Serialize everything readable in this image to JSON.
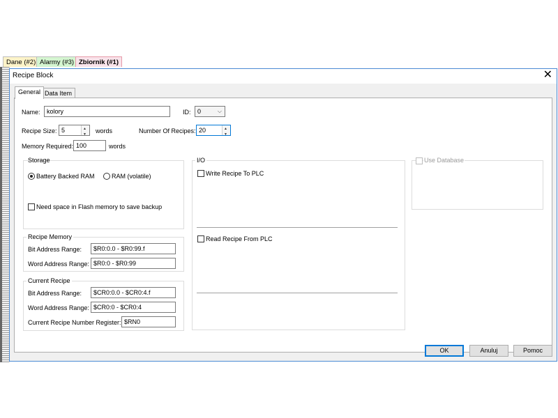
{
  "top_tabs": [
    {
      "label": "Dane (#2)",
      "bg": "#fdf3c8"
    },
    {
      "label": "Alarmy (#3)",
      "bg": "#d4f5d0"
    },
    {
      "label": "Zbiornik (#1)",
      "bg": "#f8e3ea"
    }
  ],
  "dialog": {
    "title": "Recipe Block",
    "close_glyph": "✕",
    "tabs": [
      "General",
      "Data Item"
    ],
    "buttons": {
      "ok": "OK",
      "cancel": "Anuluj",
      "help": "Pomoc"
    }
  },
  "general": {
    "name_label": "Name:",
    "name_value": "kolory",
    "id_label": "ID:",
    "id_value": "0",
    "recipe_size_label": "Recipe Size:",
    "recipe_size_value": "5",
    "recipe_size_unit": "words",
    "num_recipes_label": "Number Of Recipes:",
    "num_recipes_value": "20",
    "memory_required_label": "Memory Required:",
    "memory_required_value": "100",
    "memory_required_unit": "words"
  },
  "storage": {
    "title": "Storage",
    "battery_label": "Battery Backed RAM",
    "ram_label": "RAM (volatile)",
    "selected": "battery",
    "flash_label": "Need space in Flash memory to save backup"
  },
  "recipe_memory": {
    "title": "Recipe Memory",
    "bit_label": "Bit Address Range:",
    "bit_value": "$R0:0.0 - $R0:99.f",
    "word_label": "Word Address Range:",
    "word_value": "$R0:0 - $R0:99"
  },
  "current_recipe": {
    "title": "Current Recipe",
    "bit_label": "Bit Address Range:",
    "bit_value": "$CR0:0.0 - $CR0:4.f",
    "word_label": "Word Address Range:",
    "word_value": "$CR0:0 - $CR0:4",
    "number_label": "Current Recipe Number Register:",
    "number_value": "$RN0"
  },
  "io": {
    "title": "I/O",
    "write_label": "Write Recipe To PLC",
    "read_label": "Read Recipe From PLC"
  },
  "database": {
    "label": "Use Database"
  }
}
